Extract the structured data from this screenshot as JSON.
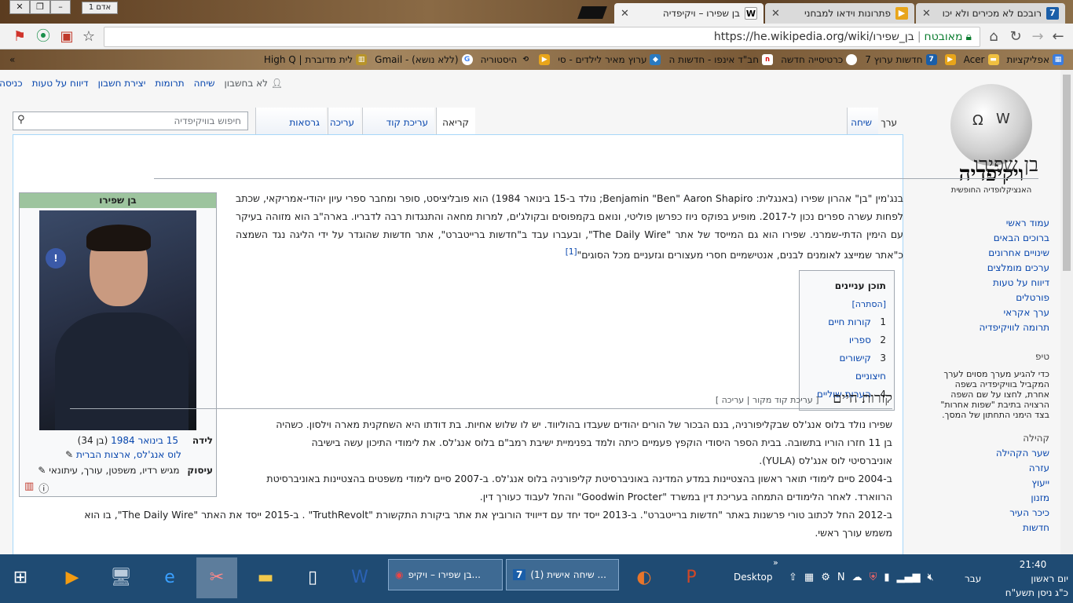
{
  "browser": {
    "tabs": [
      {
        "title": "רובכם לא מכירים ולא יכו",
        "favicon": "7",
        "color": "#1a5ea8"
      },
      {
        "title": "פתרונות וידאו למבחני",
        "favicon": "▶",
        "color": "#e8a51a"
      },
      {
        "title": "בן שפירו – ויקיפדיה",
        "favicon": "W",
        "color": "#333"
      }
    ],
    "user_badge": "אדם 1",
    "url_label": "מאובטח",
    "url": "https://he.wikipedia.org/wiki/בן_שפירו",
    "bookmarks": [
      "אפליקציות",
      "Acer",
      "",
      "חדשות ערוץ 7",
      "כרטיסייה חדשה",
      "חב\"ד אינפו - חדשות ה",
      "ערוץ מאיר לילדים - סי",
      "היסטוריה",
      "(ללא נושא) - Gmail",
      "לית מדוברת | High Q"
    ]
  },
  "wiki": {
    "personal": [
      "לא בחשבון",
      "שיחה",
      "תרומות",
      "יצירת חשבון",
      "דיווח על טעות",
      "כניסה לחשבון"
    ],
    "logo_name": "ויקיפדיה",
    "logo_tag": "האנציקלופדיה החופשית",
    "nav": [
      "עמוד ראשי",
      "ברוכים הבאים",
      "שינויים אחרונים",
      "ערכים מומלצים",
      "דיווח על טעות",
      "פורטלים",
      "ערך אקראי",
      "תרומה לוויקיפדיה"
    ],
    "tip_heading": "טיפ",
    "tip_text": "כדי להגיע מערך מסוים לערך המקביל בוויקיפדיה בשפה אחרת, לחצו על שם השפה הרצויה בתיבת \"שפות אחרות\" בצד הימני התחתון של המסך.",
    "community_heading": "קהילה",
    "community": [
      "שער הקהילה",
      "עזרה",
      "ייעוץ",
      "מזנון",
      "כיכר העיר",
      "חדשות"
    ],
    "tabs_right": [
      "ערך",
      "שיחה"
    ],
    "tabs_left": [
      "קריאה",
      "עריכת קוד מקור",
      "עריכה",
      "גרסאות קודמות"
    ],
    "search_placeholder": "חיפוש בוויקיפדיה",
    "title": "בן שפירו",
    "intro": "בנג'מין \"בן\" אהרון שפירו (באנגלית: Benjamin \"Ben\" Aaron Shapiro; נולד ב-15 בינואר 1984) הוא פובליציסט, סופר ומחבר ספרי עיון יהודי-אמריקאי, שכתב לפחות עשרה ספרים נכון ל-2017. מופיע בפוקס ניוז כפרשן פוליטי, ונואם בקמפוסים ובקולג'ים, למרות מחאה והתנגדות רבה לדבריו. בארה\"ב הוא מזוהה בעיקר עם הימין הדתי-שמרני. שפירו הוא גם המייסד של אתר \"The Daily Wire\", ובעברו עבד ב\"חדשות ברייטברט\", אתר חדשות שהוגדר על ידי הליגה נגד השמצה כ\"אתר שמייצג לאומנים לבנים, אנטישמיים חסרי מעצורים וגזעניים מכל הסוגים\"",
    "intro_ref": "[1]",
    "toc": {
      "title": "תוכן עניינים",
      "hide": "[הסתרה]",
      "items": [
        [
          "1",
          "קורות חיים"
        ],
        [
          "2",
          "ספריו"
        ],
        [
          "3",
          "קישורים חיצוניים"
        ],
        [
          "4",
          "הערות שוליים"
        ]
      ]
    },
    "infobox": {
      "title": "בן שפירו",
      "birth_label": "לידה",
      "birth_date": "15 בינואר 1984",
      "age": "(בן 34)",
      "birth_place": "לוס אנג'לס, ארצות הברית",
      "occupation_label": "עיסוק",
      "occupation": "מגיש רדיו, משפטן, עורך, עיתונאי"
    },
    "section": {
      "title": "קורות חיים",
      "edit": "[ עריכת קוד מקור | עריכה ]"
    },
    "para1": "שפירו נולד בלוס אנג'לס שבקליפורניה, בנם הבכור של הורים יהודים שעבדו בהוליווד. יש לו שלוש אחיות. בת דודתו היא השחקנית מארה וילסון. כשהיה בן 11 חזרו הוריו בתשובה. בבית הספר היסודי הוקפץ פעמיים כיתה ולמד בפנימיית ישיבת רמב\"ם בלוס אנג'לס. את לימודי התיכון עשה בישיבה אוניברסיטי לוס אנג'לס (YULA).",
    "para2": "ב-2004 סיים לימודי תואר ראשון בהצטיינות במדע המדינה באוניברסיטת קליפורניה בלוס אנג'לס. ב-2007 סיים לימודי משפטים בהצטיינות באוניברסיטת הרווארד. לאחר הלימודים התמחה בעריכת דין במשרד \"Goodwin Procter\" והחל לעבוד כעורך דין.",
    "para3": "ב-2012 החל לכתוב טורי פרשנות באתר \"חדשות ברייטברט\". ב-2013 ייסד יחד עם דייוויד הורוביץ את אתר ביקורת התקשורת \"TruthRevolt\" . ב-2015 ייסד את האתר \"The Daily Wire\", בו הוא משמש עורך ראשי."
  },
  "taskbar": {
    "windows": [
      "בן שפירו – ויקיפ...",
      "(1) שיחה אישית ..."
    ],
    "desktop": "Desktop",
    "lang": "עבר",
    "time": "21:40",
    "day": "יום ראשון",
    "hebdate": "כ\"ג ניסן תשע\"ח"
  }
}
